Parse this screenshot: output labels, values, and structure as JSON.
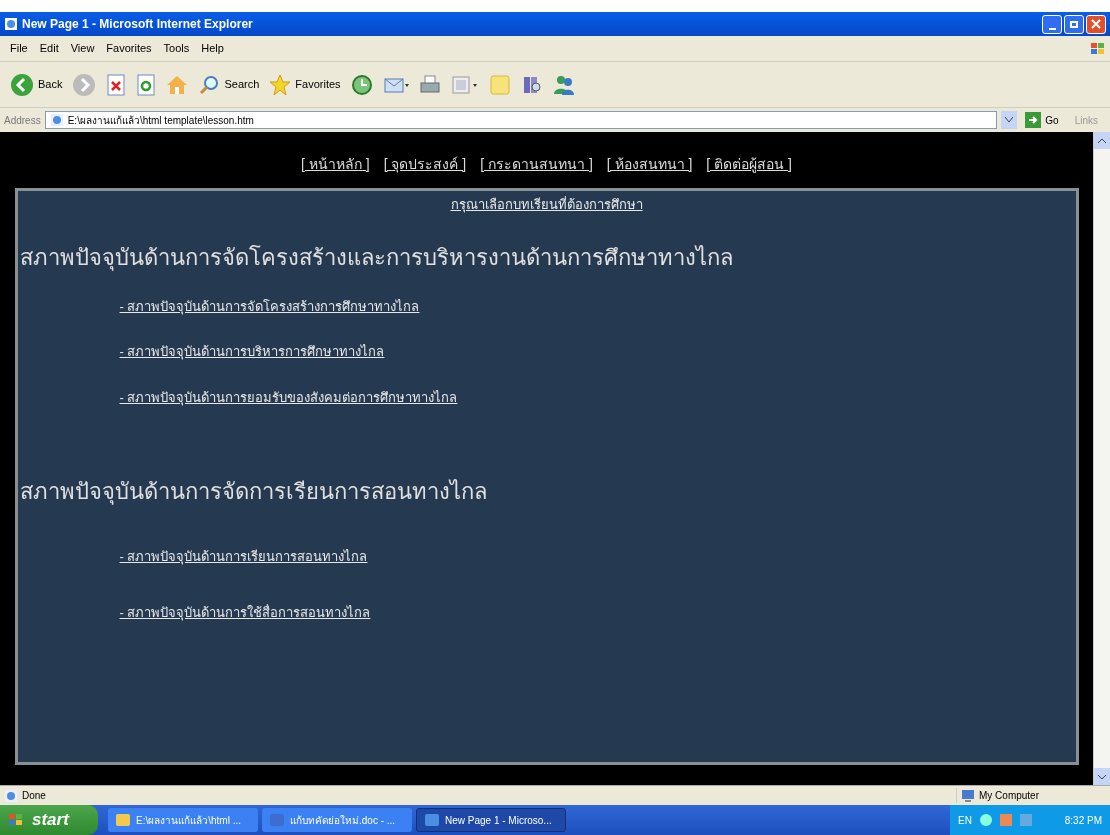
{
  "window": {
    "title": "New Page 1 - Microsoft Internet Explorer"
  },
  "menu": [
    "File",
    "Edit",
    "View",
    "Favorites",
    "Tools",
    "Help"
  ],
  "toolbar": [
    {
      "kind": "back",
      "label": "Back"
    },
    {
      "kind": "forward"
    },
    {
      "kind": "stop"
    },
    {
      "kind": "refresh"
    },
    {
      "kind": "home"
    },
    {
      "kind": "search",
      "label": "Search"
    },
    {
      "kind": "favorites",
      "label": "Favorites"
    },
    {
      "kind": "history"
    },
    {
      "kind": "mail"
    },
    {
      "kind": "print"
    },
    {
      "kind": "edit"
    },
    {
      "kind": "note"
    },
    {
      "kind": "research"
    },
    {
      "kind": "messenger"
    }
  ],
  "address": {
    "label": "Address",
    "value": "E:\\ผลงานแก้แล้ว\\html template\\lesson.htm",
    "go": "Go",
    "links": "Links"
  },
  "page": {
    "nav": [
      "[ หน้าหลัก ]",
      "[ จุดประสงค์ ]",
      "[ กระดานสนทนา ]",
      "[ ห้องสนทนา ]",
      "[ ติดต่อผู้สอน ]"
    ],
    "prompt": "กรุณาเลือกบทเรียนที่ต้องการศึกษา",
    "sections": [
      {
        "heading": "สภาพปัจจุบันด้านการจัดโครงสร้างและการบริหารงานด้านการศึกษาทางไกล",
        "links": [
          "- สภาพปัจจุบันด้านการจัดโครงสร้างการศึกษาทางไกล",
          "- สภาพปัจจุบันด้านการบริหารการศึกษาทางไกล",
          "- สภาพปัจจุบันด้านการยอมรับของสังคมต่อการศึกษาทางไกล"
        ]
      },
      {
        "heading": "สภาพปัจจุบันด้านการจัดการเรียนการสอนทางไกล",
        "links": [
          "- สภาพปัจจุบันด้านการเรียนการสอนทางไกล",
          "- สภาพปัจจุบันด้านการใช้สื่อการสอนทางไกล"
        ]
      }
    ]
  },
  "status_bar": {
    "text": "Done",
    "zone": "My Computer"
  },
  "taskbar": {
    "start": "start",
    "items": [
      {
        "label": "E:\\ผลงานแก้แล้ว\\html ...",
        "kind": "folder",
        "selected": false
      },
      {
        "label": "แก้บทคัดย่อใหม่.doc - ...",
        "kind": "word",
        "selected": false
      },
      {
        "label": "New Page 1 - Microso...",
        "kind": "ie",
        "selected": true
      }
    ],
    "lang": "EN",
    "clock": "8:32 PM"
  }
}
